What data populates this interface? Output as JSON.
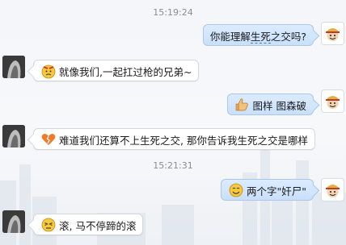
{
  "chat": {
    "timestamps": [
      "15:19:24",
      "15:21:31"
    ],
    "messages": [
      {
        "side": "right",
        "text_pre": "你能理解",
        "text_link": "生死",
        "text_post": "之交吗?"
      },
      {
        "side": "left",
        "emoji": "angry-face-icon",
        "text": "就像我们,一起扛过枪的兄弟~"
      },
      {
        "side": "right",
        "emoji": "thumbs-up-icon",
        "text": "图样 图森破"
      },
      {
        "side": "left",
        "emoji": "broken-heart-icon",
        "text": "难道我们还算不上生死之交, 那你告诉我生死之交是哪样"
      },
      {
        "side": "right",
        "emoji": "smiley-face-icon",
        "text": "两个字\"奸尸\""
      },
      {
        "side": "left",
        "emoji": "squint-face-icon",
        "text": "滚, 马不停蹄的滚"
      }
    ]
  },
  "colors": {
    "right_bubble": "#c9e0fa",
    "left_bubble": "#ffffff",
    "timestamp": "#8c8c8c"
  }
}
